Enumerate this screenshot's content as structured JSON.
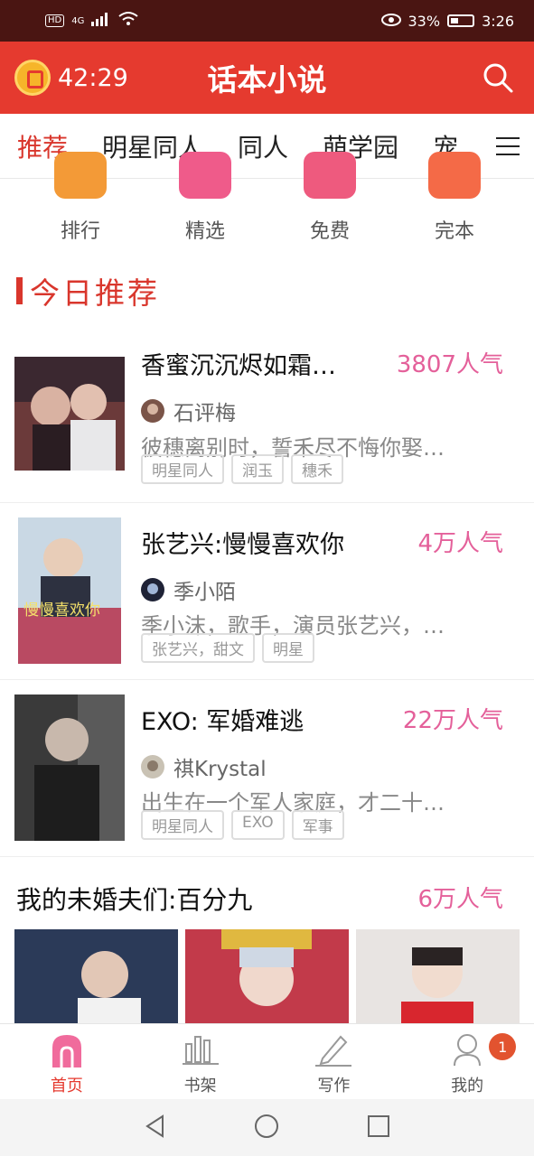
{
  "status_bar": {
    "hd": "HD",
    "network": "4G",
    "battery": "33%",
    "time": "3:26"
  },
  "header": {
    "timer": "42:29",
    "title": "话本小说"
  },
  "tabs": [
    "推荐",
    "明星同人",
    "同人",
    "萌学园",
    "宠"
  ],
  "shortcuts": [
    "排行",
    "精选",
    "免费",
    "完本"
  ],
  "section": {
    "title": "今日推荐"
  },
  "books": [
    {
      "title": "香蜜沉沉烬如霜…",
      "popularity": "3807人气",
      "author": "石评梅",
      "description": "彼穗离别时，誓禾尽不悔你娶…",
      "tags": [
        "明星同人",
        "润玉",
        "穗禾"
      ]
    },
    {
      "title": "张艺兴:慢慢喜欢你",
      "popularity": "4万人气",
      "author": "季小陌",
      "description": "季小沫，歌手，演员张艺兴，…",
      "tags": [
        "张艺兴，甜文",
        "明星"
      ],
      "cover_text": "慢慢喜欢你"
    },
    {
      "title": "EXO: 军婚难逃",
      "popularity": "22万人气",
      "author": "祺Krystal",
      "description": "出生在一个军人家庭，才二十…",
      "tags": [
        "明星同人",
        "EXO",
        "军事"
      ]
    }
  ],
  "collection": {
    "title": "我的未婚夫们:百分九",
    "popularity": "6万人气"
  },
  "bottom_nav": [
    {
      "label": "首页",
      "icon": "home-icon",
      "active": true
    },
    {
      "label": "书架",
      "icon": "bookshelf-icon",
      "active": false
    },
    {
      "label": "写作",
      "icon": "pen-icon",
      "active": false
    },
    {
      "label": "我的",
      "icon": "profile-icon",
      "active": false,
      "badge": "1"
    }
  ],
  "colors": {
    "status_bar": "#4a1512",
    "header": "#e53a2f",
    "accent": "#d9362c",
    "popularity": "#e4609a"
  }
}
